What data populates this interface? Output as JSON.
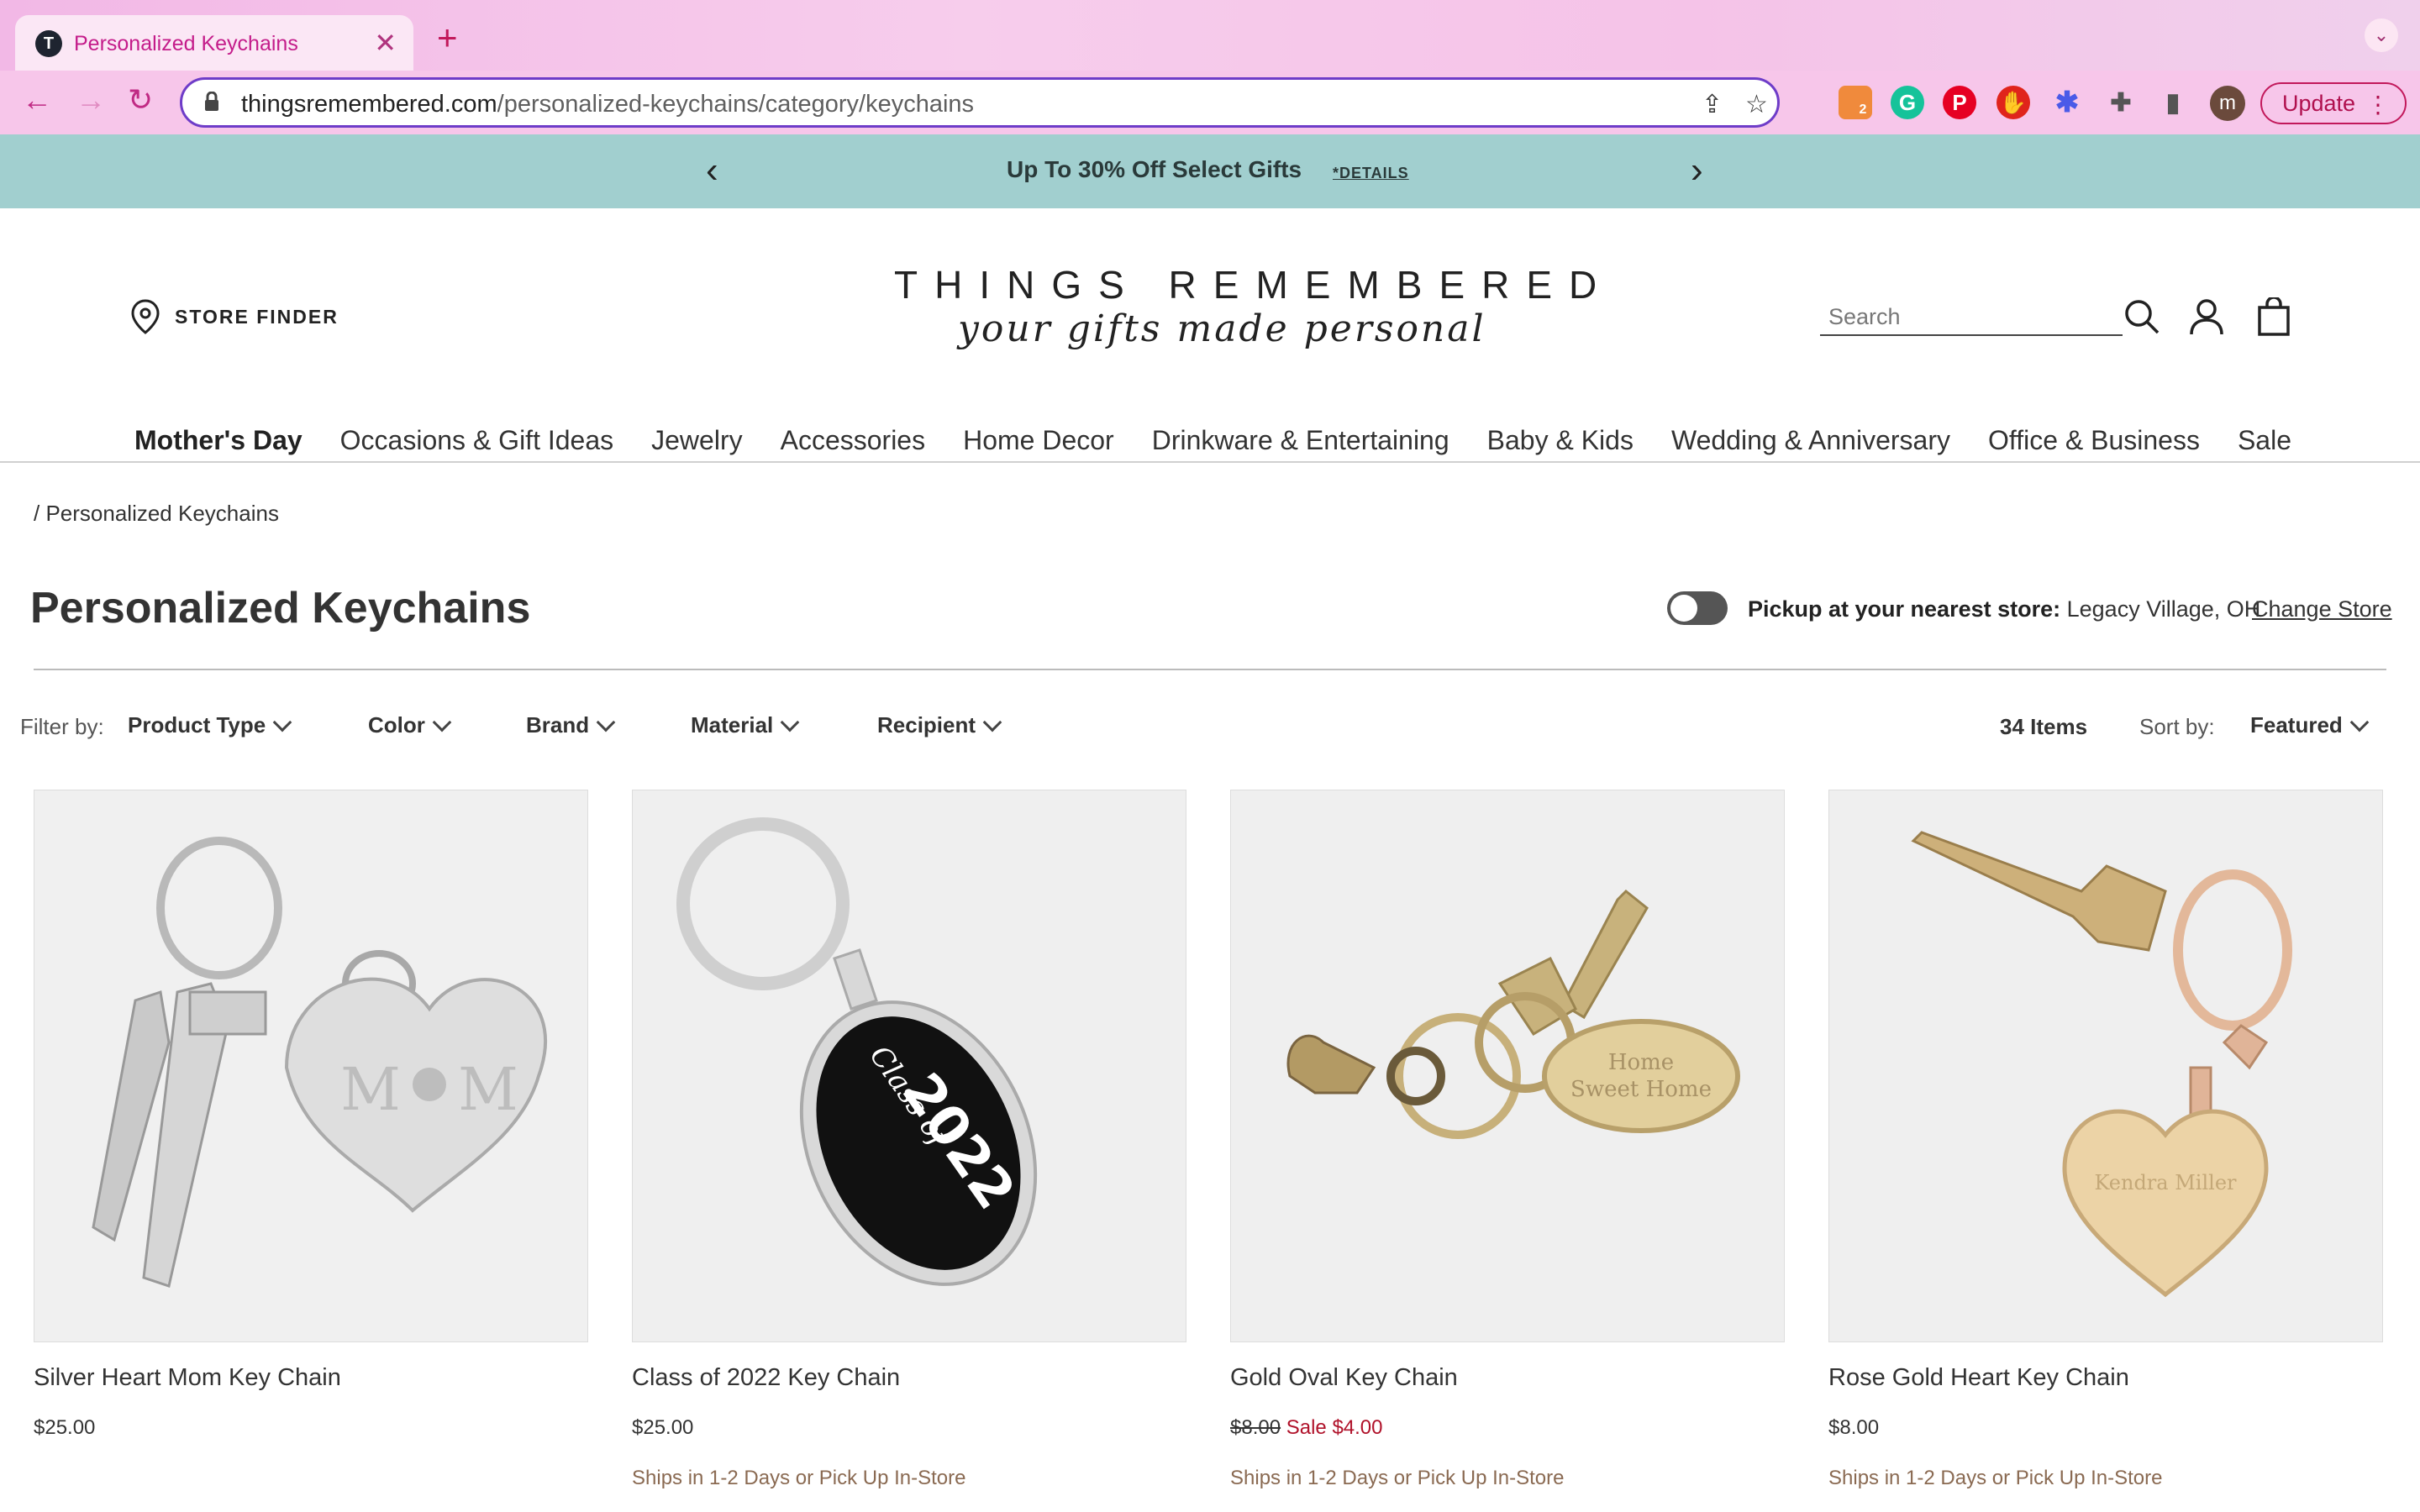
{
  "browser": {
    "tab_title": "Personalized Keychains",
    "tab_favicon_letter": "T",
    "new_tab": "+",
    "url_host": "thingsremembered.com",
    "url_path": "/personalized-keychains/category/keychains",
    "profile_initial": "m",
    "update_label": "Update",
    "extension_badge": "2"
  },
  "promo": {
    "text": "Up To 30% Off Select Gifts",
    "details": "*DETAILS"
  },
  "header": {
    "store_finder": "STORE FINDER",
    "logo_main": "THINGS REMEMBERED",
    "logo_tagline": "your gifts made personal",
    "search_placeholder": "Search"
  },
  "nav": {
    "items": [
      "Mother's Day",
      "Occasions & Gift Ideas",
      "Jewelry",
      "Accessories",
      "Home Decor",
      "Drinkware & Entertaining",
      "Baby & Kids",
      "Wedding & Anniversary",
      "Office & Business",
      "Sale"
    ]
  },
  "page": {
    "breadcrumb": "/ Personalized Keychains",
    "title": "Personalized Keychains",
    "pickup_label": "Pickup at your nearest store:",
    "pickup_store": " Legacy Village, OH",
    "change_store": "Change Store"
  },
  "filters": {
    "label": "Filter by:",
    "items": [
      "Product Type",
      "Color",
      "Brand",
      "Material",
      "Recipient"
    ],
    "items_count": "34 Items",
    "sort_label": "Sort by:",
    "sort_value": "Featured"
  },
  "products": [
    {
      "name": "Silver Heart Mom Key Chain",
      "price": "$25.00",
      "ship": ""
    },
    {
      "name": "Class of 2022 Key Chain",
      "price": "$25.00",
      "ship": "Ships in 1-2 Days or Pick Up In-Store"
    },
    {
      "name": "Gold Oval Key Chain",
      "old_price": "$8.00",
      "sale_price": "Sale $4.00",
      "ship": "Ships in 1-2 Days or Pick Up In-Store"
    },
    {
      "name": "Rose Gold Heart Key Chain",
      "price": "$8.00",
      "ship": "Ships in 1-2 Days or Pick Up In-Store"
    }
  ],
  "engravings": {
    "mom": "M",
    "mom_end": "M",
    "class_of": "Class of",
    "year": "2022",
    "home_line1": "Home",
    "home_line2": "Sweet Home",
    "name": "Kendra Miller"
  }
}
